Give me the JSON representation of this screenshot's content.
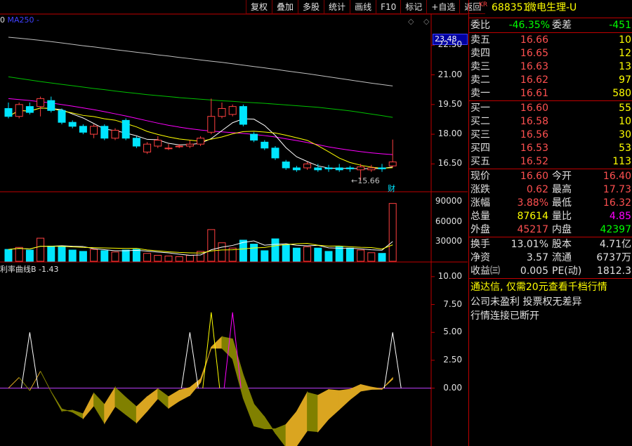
{
  "toolbar": {
    "buttons": [
      "复权",
      "叠加",
      "多股",
      "统计",
      "画线",
      "F10",
      "标记",
      "+自选",
      "返回"
    ]
  },
  "chart": {
    "ma_label": "MA250",
    "last_price_tag": "23.48",
    "price_axis": [
      "22.50",
      "21.00",
      "19.50",
      "18.00",
      "16.50"
    ],
    "low_marker": "15.66",
    "fin_marker": "财",
    "vol_axis": [
      "90000",
      "60000",
      "30000"
    ],
    "ind_label": "利率曲线B -1.43",
    "ind_axis": [
      "10.00",
      "7.50",
      "5.00",
      "2.50",
      "0.00"
    ],
    "colors": {
      "up": "#ff4040",
      "down": "#00e5ff",
      "ma5": "#ffffff",
      "ma10": "#ffff00",
      "ma30": "#ff00ff",
      "ma60": "#00c000",
      "ma250": "#c0c0c0"
    }
  },
  "chart_data": {
    "type": "candlestick",
    "candles": [
      {
        "o": 19.3,
        "c": 18.9,
        "h": 19.6,
        "l": 18.8
      },
      {
        "o": 18.9,
        "c": 19.5,
        "h": 19.6,
        "l": 18.8
      },
      {
        "o": 19.4,
        "c": 19.1,
        "h": 19.6,
        "l": 19.0
      },
      {
        "o": 19.4,
        "c": 19.8,
        "h": 19.9,
        "l": 18.9
      },
      {
        "o": 19.7,
        "c": 19.2,
        "h": 19.9,
        "l": 19.1
      },
      {
        "o": 19.2,
        "c": 18.6,
        "h": 19.3,
        "l": 18.5
      },
      {
        "o": 18.6,
        "c": 18.4,
        "h": 18.7,
        "l": 18.3
      },
      {
        "o": 18.4,
        "c": 18.1,
        "h": 18.5,
        "l": 18.0
      },
      {
        "o": 18.0,
        "c": 18.4,
        "h": 18.5,
        "l": 17.8
      },
      {
        "o": 18.4,
        "c": 17.8,
        "h": 18.5,
        "l": 17.7
      },
      {
        "o": 17.8,
        "c": 18.2,
        "h": 18.3,
        "l": 17.7
      },
      {
        "o": 18.7,
        "c": 17.8,
        "h": 18.8,
        "l": 17.7
      },
      {
        "o": 17.8,
        "c": 17.4,
        "h": 17.9,
        "l": 17.3
      },
      {
        "o": 17.1,
        "c": 17.5,
        "h": 17.6,
        "l": 17.0
      },
      {
        "o": 17.4,
        "c": 17.7,
        "h": 17.9,
        "l": 17.3
      },
      {
        "o": 17.3,
        "c": 17.3,
        "h": 17.5,
        "l": 17.2
      },
      {
        "o": 17.4,
        "c": 17.4,
        "h": 17.5,
        "l": 17.3
      },
      {
        "o": 17.4,
        "c": 17.5,
        "h": 17.7,
        "l": 17.3
      },
      {
        "o": 17.5,
        "c": 17.8,
        "h": 17.9,
        "l": 17.4
      },
      {
        "o": 18.1,
        "c": 18.9,
        "h": 19.8,
        "l": 18.0
      },
      {
        "o": 18.9,
        "c": 19.3,
        "h": 19.6,
        "l": 18.8
      },
      {
        "o": 19.0,
        "c": 19.4,
        "h": 19.5,
        "l": 18.9
      },
      {
        "o": 19.4,
        "c": 18.5,
        "h": 19.5,
        "l": 18.4
      },
      {
        "o": 18.0,
        "c": 17.7,
        "h": 18.1,
        "l": 17.6
      },
      {
        "o": 17.6,
        "c": 17.3,
        "h": 17.7,
        "l": 17.2
      },
      {
        "o": 17.3,
        "c": 16.8,
        "h": 17.4,
        "l": 16.7
      },
      {
        "o": 16.6,
        "c": 16.3,
        "h": 16.7,
        "l": 16.2
      },
      {
        "o": 16.3,
        "c": 16.2,
        "h": 16.4,
        "l": 16.1
      },
      {
        "o": 16.3,
        "c": 16.5,
        "h": 16.6,
        "l": 16.2
      },
      {
        "o": 16.3,
        "c": 16.2,
        "h": 16.5,
        "l": 16.1
      },
      {
        "o": 16.3,
        "c": 16.25,
        "h": 16.45,
        "l": 16.1
      },
      {
        "o": 16.3,
        "c": 16.2,
        "h": 16.5,
        "l": 16.1
      },
      {
        "o": 16.3,
        "c": 16.25,
        "h": 16.4,
        "l": 16.1
      },
      {
        "o": 16.2,
        "c": 16.35,
        "h": 16.5,
        "l": 15.66
      },
      {
        "o": 16.2,
        "c": 16.3,
        "h": 16.45,
        "l": 16.1
      },
      {
        "o": 16.3,
        "c": 16.25,
        "h": 16.5,
        "l": 16.1
      },
      {
        "o": 16.4,
        "c": 16.6,
        "h": 17.73,
        "l": 16.32
      }
    ],
    "volumes": [
      18000,
      21000,
      17000,
      35000,
      23000,
      22000,
      17000,
      15000,
      18000,
      16000,
      14000,
      17000,
      18000,
      12000,
      9000,
      8000,
      7000,
      9000,
      15000,
      48000,
      28000,
      20000,
      32000,
      26000,
      16000,
      34000,
      25000,
      20000,
      22000,
      20000,
      15000,
      22000,
      20000,
      17000,
      13000,
      12000,
      87614
    ],
    "ma250": [
      22.9,
      22.85,
      22.8,
      22.74,
      22.68,
      22.61,
      22.54,
      22.47,
      22.41,
      22.34,
      22.27,
      22.21,
      22.14,
      22.08,
      22.01,
      21.95,
      21.88,
      21.82,
      21.75,
      21.69,
      21.63,
      21.56,
      21.49,
      21.42,
      21.35,
      21.28,
      21.2,
      21.13,
      21.06,
      20.98,
      20.9,
      20.82,
      20.74,
      20.66,
      20.58,
      20.51,
      20.44
    ],
    "ma60": [
      20.9,
      20.82,
      20.74,
      20.66,
      20.59,
      20.52,
      20.45,
      20.38,
      20.31,
      20.25,
      20.18,
      20.12,
      20.06,
      20.0,
      19.95,
      19.9,
      19.85,
      19.81,
      19.77,
      19.73,
      19.69,
      19.66,
      19.62,
      19.59,
      19.56,
      19.52,
      19.48,
      19.44,
      19.4,
      19.36,
      19.3,
      19.24,
      19.18,
      19.1,
      19.02,
      18.94,
      18.85
    ],
    "ma30": [
      19.8,
      19.75,
      19.7,
      19.64,
      19.58,
      19.5,
      19.42,
      19.33,
      19.24,
      19.14,
      19.03,
      18.92,
      18.8,
      18.68,
      18.56,
      18.45,
      18.36,
      18.28,
      18.21,
      18.16,
      18.12,
      18.08,
      18.04,
      17.99,
      17.93,
      17.86,
      17.77,
      17.68,
      17.58,
      17.47,
      17.36,
      17.27,
      17.19,
      17.12,
      17.06,
      17.01,
      16.97
    ],
    "indicator_top_label": "利率曲线B",
    "indicator_value": -1.43,
    "ylim_price": [
      15.2,
      24.0
    ],
    "ylim_vol": [
      0,
      100000
    ],
    "ylim_ind": [
      -5.0,
      11.0
    ]
  },
  "quote": {
    "market_badge": "KR",
    "code": "688351",
    "name": "微电生理-U",
    "weibi_label": "委比",
    "weibi": "-46.35%",
    "weicha_label": "委差",
    "weicha": "-451",
    "asks": [
      {
        "label": "卖五",
        "price": "16.66",
        "vol": "10"
      },
      {
        "label": "卖四",
        "price": "16.65",
        "vol": "12"
      },
      {
        "label": "卖三",
        "price": "16.63",
        "vol": "13"
      },
      {
        "label": "卖二",
        "price": "16.62",
        "vol": "97"
      },
      {
        "label": "卖一",
        "price": "16.61",
        "vol": "580"
      }
    ],
    "bids": [
      {
        "label": "买一",
        "price": "16.60",
        "vol": "55"
      },
      {
        "label": "买二",
        "price": "16.58",
        "vol": "10"
      },
      {
        "label": "买三",
        "price": "16.56",
        "vol": "30"
      },
      {
        "label": "买四",
        "price": "16.53",
        "vol": "53"
      },
      {
        "label": "买五",
        "price": "16.52",
        "vol": "113"
      }
    ],
    "stats": [
      {
        "l1": "现价",
        "v1": "16.60",
        "c1": "red",
        "l2": "今开",
        "v2": "16.40",
        "c2": "red"
      },
      {
        "l1": "涨跌",
        "v1": "0.62",
        "c1": "red",
        "l2": "最高",
        "v2": "17.73",
        "c2": "red"
      },
      {
        "l1": "涨幅",
        "v1": "3.88%",
        "c1": "red",
        "l2": "最低",
        "v2": "16.32",
        "c2": "red"
      },
      {
        "l1": "总量",
        "v1": "87614",
        "c1": "yellow",
        "l2": "量比",
        "v2": "4.85",
        "c2": "magenta"
      },
      {
        "l1": "外盘",
        "v1": "45217",
        "c1": "red",
        "l2": "内盘",
        "v2": "42397",
        "c2": "green"
      }
    ],
    "fund": [
      {
        "l1": "换手",
        "v1": "13.01%",
        "l2": "股本",
        "v2": "4.71亿"
      },
      {
        "l1": "净资",
        "v1": "3.57",
        "l2": "流通",
        "v2": "6737万"
      },
      {
        "l1": "收益㈢",
        "v1": "0.005",
        "l2": "PE(动)",
        "v2": "1812.3"
      }
    ],
    "messages": [
      "通达信, 仅需20元查看千档行情",
      "公司未盈利 投票权无差异",
      "行情连接已断开"
    ]
  }
}
